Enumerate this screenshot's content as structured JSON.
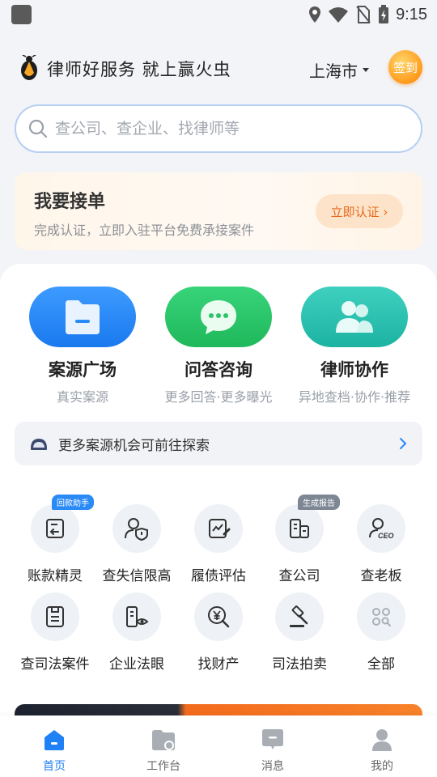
{
  "status_bar": {
    "time": "9:15"
  },
  "header": {
    "slogan": "律师好服务 就上赢火虫",
    "city": "上海市",
    "signin_label": "签到"
  },
  "search": {
    "placeholder": "查公司、查企业、找律师等"
  },
  "order_card": {
    "title": "我要接单",
    "subtitle": "完成认证，立即入驻平台免费承接案件",
    "button_label": "立即认证 ›"
  },
  "features": [
    {
      "title": "案源广场",
      "subtitle": "真实案源",
      "icon": "folder-icon",
      "color": "#2a8af6"
    },
    {
      "title": "问答咨询",
      "subtitle": "更多回答·更多曝光",
      "icon": "chat-bubble-icon",
      "color": "#27c468"
    },
    {
      "title": "律师协作",
      "subtitle": "异地查档·协作·推荐",
      "icon": "people-icon",
      "color": "#23bfae"
    }
  ],
  "explore": {
    "text": "更多案源机会可前往探索"
  },
  "tools": [
    {
      "label": "账款精灵",
      "icon": "invoice-icon",
      "badge": "回款助手",
      "badge_color": "#2a8af6"
    },
    {
      "label": "查失信限高",
      "icon": "person-shield-icon"
    },
    {
      "label": "履债评估",
      "icon": "chart-edit-icon"
    },
    {
      "label": "查公司",
      "icon": "building-icon",
      "badge": "生成报告",
      "badge_color": "#7d8794"
    },
    {
      "label": "查老板",
      "icon": "ceo-icon",
      "icon_text": "CEO"
    },
    {
      "label": "查司法案件",
      "icon": "case-file-icon"
    },
    {
      "label": "企业法眼",
      "icon": "building-eye-icon"
    },
    {
      "label": "找财产",
      "icon": "yuan-search-icon"
    },
    {
      "label": "司法拍卖",
      "icon": "gavel-icon"
    },
    {
      "label": "全部",
      "icon": "grid-dots-icon"
    }
  ],
  "bottom_nav": [
    {
      "label": "首页",
      "icon": "home-icon",
      "active": true
    },
    {
      "label": "工作台",
      "icon": "workbench-icon",
      "active": false
    },
    {
      "label": "消息",
      "icon": "message-icon",
      "active": false
    },
    {
      "label": "我的",
      "icon": "profile-icon",
      "active": false
    }
  ],
  "colors": {
    "accent": "#2080f5",
    "orange": "#e5691c"
  }
}
